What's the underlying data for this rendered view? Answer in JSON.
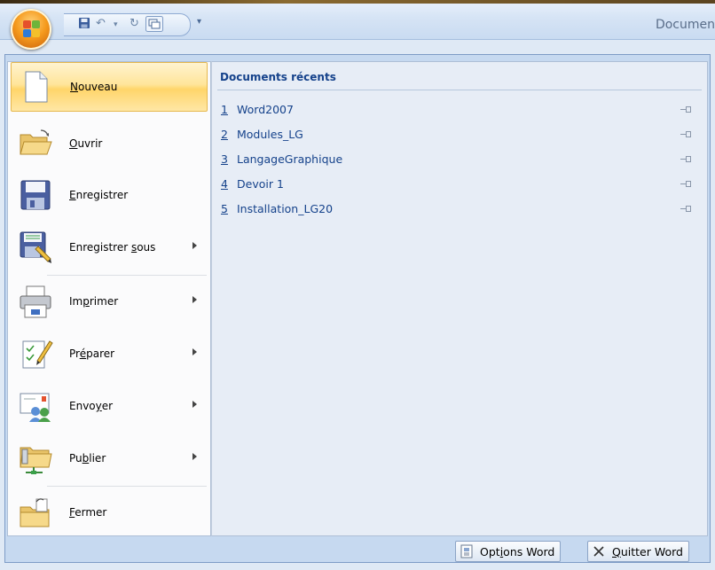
{
  "window": {
    "title": "Documen"
  },
  "qat": {
    "save_icon": "floppy-icon",
    "undo_icon": "undo-icon",
    "redo_icon": "redo-icon",
    "window_icon": "window-icon"
  },
  "menu_items": [
    {
      "pre": "",
      "key": "N",
      "post": "ouveau",
      "icon": "new-document-icon",
      "active": true,
      "submenu": false
    },
    {
      "pre": "",
      "key": "O",
      "post": "uvrir",
      "icon": "open-folder-icon",
      "active": false,
      "submenu": false
    },
    {
      "pre": "",
      "key": "E",
      "post": "nregistrer",
      "icon": "save-icon",
      "active": false,
      "submenu": false
    },
    {
      "pre": "Enregistrer ",
      "key": "s",
      "post": "ous",
      "icon": "save-as-icon",
      "active": false,
      "submenu": true
    },
    {
      "pre": "Im",
      "key": "p",
      "post": "rimer",
      "icon": "printer-icon",
      "active": false,
      "submenu": true
    },
    {
      "pre": "Pr",
      "key": "é",
      "post": "parer",
      "icon": "prepare-icon",
      "active": false,
      "submenu": true
    },
    {
      "pre": "Envo",
      "key": "y",
      "post": "er",
      "icon": "send-icon",
      "active": false,
      "submenu": true
    },
    {
      "pre": "Pu",
      "key": "b",
      "post": "lier",
      "icon": "publish-icon",
      "active": false,
      "submenu": true
    },
    {
      "pre": "",
      "key": "F",
      "post": "ermer",
      "icon": "close-folder-icon",
      "active": false,
      "submenu": false
    }
  ],
  "recent": {
    "title": "Documents récents",
    "items": [
      {
        "num": "1",
        "name": "Word2007"
      },
      {
        "num": "2",
        "name": "Modules_LG"
      },
      {
        "num": "3",
        "name": "LangageGraphique"
      },
      {
        "num": "4",
        "name": "Devoir 1"
      },
      {
        "num": "5",
        "name": "Installation_LG20"
      }
    ]
  },
  "bottom": {
    "options": {
      "pre": "Opt",
      "key": "i",
      "post": "ons Word"
    },
    "quit": {
      "pre": "",
      "key": "Q",
      "post": "uitter Word"
    }
  },
  "colors": {
    "accent": "#15428b",
    "highlight": "#ffe59a",
    "office_orange": "#f59a1d"
  }
}
